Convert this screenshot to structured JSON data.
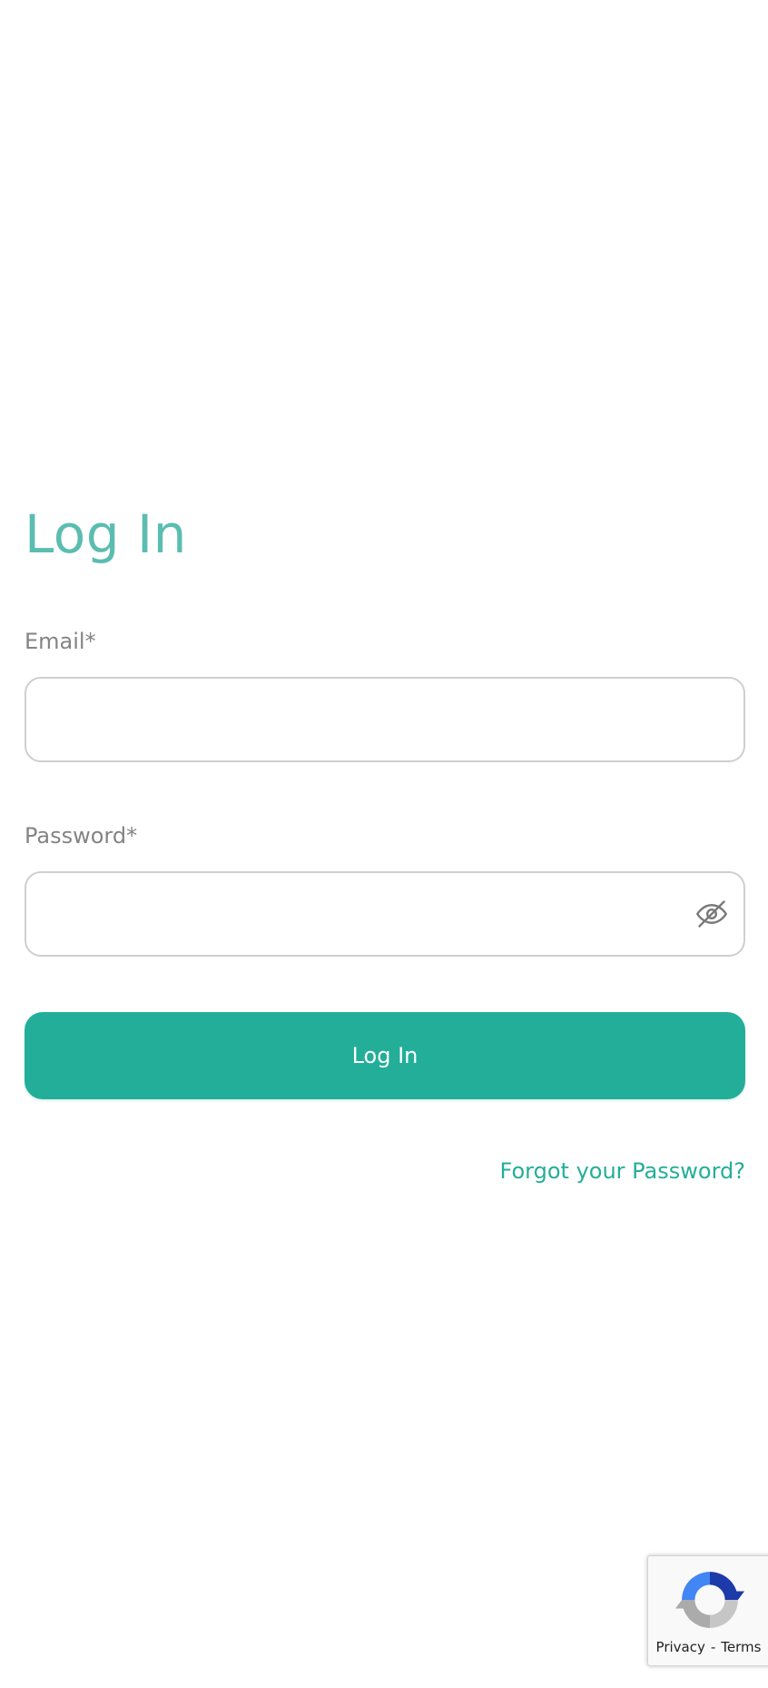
{
  "page": {
    "title": "Log In"
  },
  "form": {
    "email_label": "Email*",
    "email_value": "",
    "password_label": "Password*",
    "password_value": "",
    "password_toggle_icon": "eye-slash-icon",
    "submit_label": "Log In",
    "forgot_password_label": "Forgot your Password?"
  },
  "recaptcha": {
    "privacy_label": "Privacy",
    "separator": "-",
    "terms_label": "Terms",
    "icon": "recaptcha-logo-icon"
  },
  "colors": {
    "title": "#5bbdb0",
    "accent": "#23ae99",
    "label": "#848484",
    "input_border": "#cfcfcf"
  }
}
